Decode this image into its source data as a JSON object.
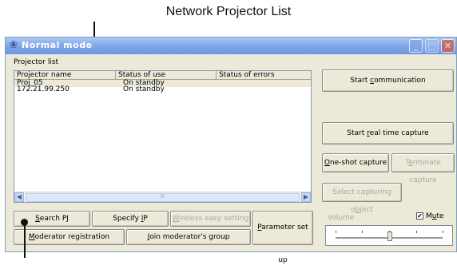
{
  "callout": {
    "title": "Network Projector List"
  },
  "window": {
    "title": "Normal mode"
  },
  "projector_list": {
    "label": "Projector list",
    "columns": [
      "Projector name",
      "Status of use",
      "Status of errors"
    ],
    "rows": [
      {
        "name": "Proj_05",
        "status": "On standby",
        "errors": ""
      },
      {
        "name": "172.21.99.250",
        "status": "On standby",
        "errors": ""
      }
    ],
    "scroll_thumb": "III"
  },
  "buttons": {
    "search_pj": {
      "pre": "",
      "key": "S",
      "post": "earch PJ"
    },
    "specify_ip": {
      "pre": "Specify ",
      "key": "I",
      "post": "P"
    },
    "wireless": {
      "pre": "",
      "key": "W",
      "post": "ireless easy setting"
    },
    "parameter": {
      "pre": "",
      "key": "P",
      "post": "arameter set up"
    },
    "moderator_reg": {
      "pre": "",
      "key": "M",
      "post": "oderator registration"
    },
    "join_group": {
      "pre": "",
      "key": "J",
      "post": "oin moderator's group"
    },
    "start_comm": {
      "pre": "Start ",
      "key": "c",
      "post": "ommunication"
    },
    "start_rt": {
      "pre": "Start ",
      "key": "r",
      "post": "eal time capture"
    },
    "one_shot": {
      "pre": "",
      "key": "O",
      "post": "ne-shot capture"
    },
    "terminate": {
      "pre": "T",
      "key": "e",
      "post": "rminate capture"
    },
    "select_obj": {
      "pre": "Select capturing o",
      "key": "b",
      "post": "ject"
    }
  },
  "volume": {
    "label": "Volume",
    "level": 0.5
  },
  "mute": {
    "pre": "M",
    "key": "u",
    "post": "te",
    "checked": true,
    "mark": "✔"
  },
  "titlebar_buttons": {
    "min": "_",
    "max": "□",
    "close": "✕"
  }
}
